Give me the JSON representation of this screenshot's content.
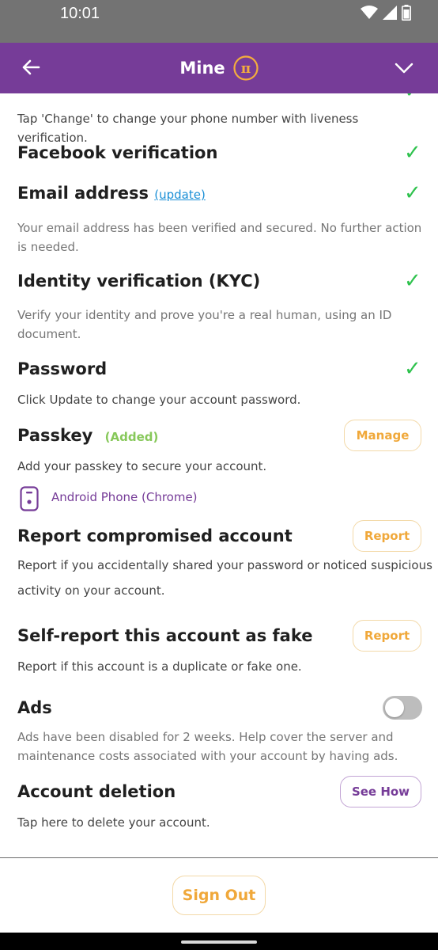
{
  "status_bar": {
    "time": "10:01"
  },
  "header": {
    "title": "Mine",
    "pi_symbol": "π"
  },
  "phone": {
    "desc": "Tap 'Change' to change your phone number with liveness verification.",
    "check": "✓"
  },
  "facebook": {
    "title": "Facebook verification",
    "check": "✓"
  },
  "email": {
    "title": "Email address",
    "link": "(update)",
    "desc": "Your email address has been verified and secured. No further action is needed.",
    "check": "✓"
  },
  "kyc": {
    "title": "Identity verification (KYC)",
    "desc": "Verify your identity and prove you're a real human, using an ID document.",
    "check": "✓"
  },
  "password": {
    "title": "Password",
    "desc": "Click Update to change your account password.",
    "check": "✓"
  },
  "passkey": {
    "title": "Passkey",
    "status": "(Added)",
    "button": "Manage",
    "desc": "Add your passkey to secure your account.",
    "device": "Android Phone (Chrome)"
  },
  "report_compromised": {
    "title": "Report compromised account",
    "button": "Report",
    "desc_line1": "Report if you accidentally shared your password or noticed suspicious",
    "desc_line2": "activity on your account."
  },
  "self_report": {
    "title": "Self-report this account as fake",
    "button": "Report",
    "desc": "Report if this account is a duplicate or fake one."
  },
  "ads": {
    "title": "Ads",
    "enabled": false,
    "desc": "Ads have been disabled for 2 weeks. Help cover the server and maintenance costs associated with your account by having ads."
  },
  "account_deletion": {
    "title": "Account deletion",
    "button": "See How",
    "desc": "Tap here to delete your account."
  },
  "footer": {
    "sign_out": "Sign Out"
  },
  "colors": {
    "header": "#763c98",
    "check": "#2ec24d",
    "accent_orange": "#f0a83a",
    "link_blue": "#1a8fd6",
    "added_green": "#87c85a"
  }
}
